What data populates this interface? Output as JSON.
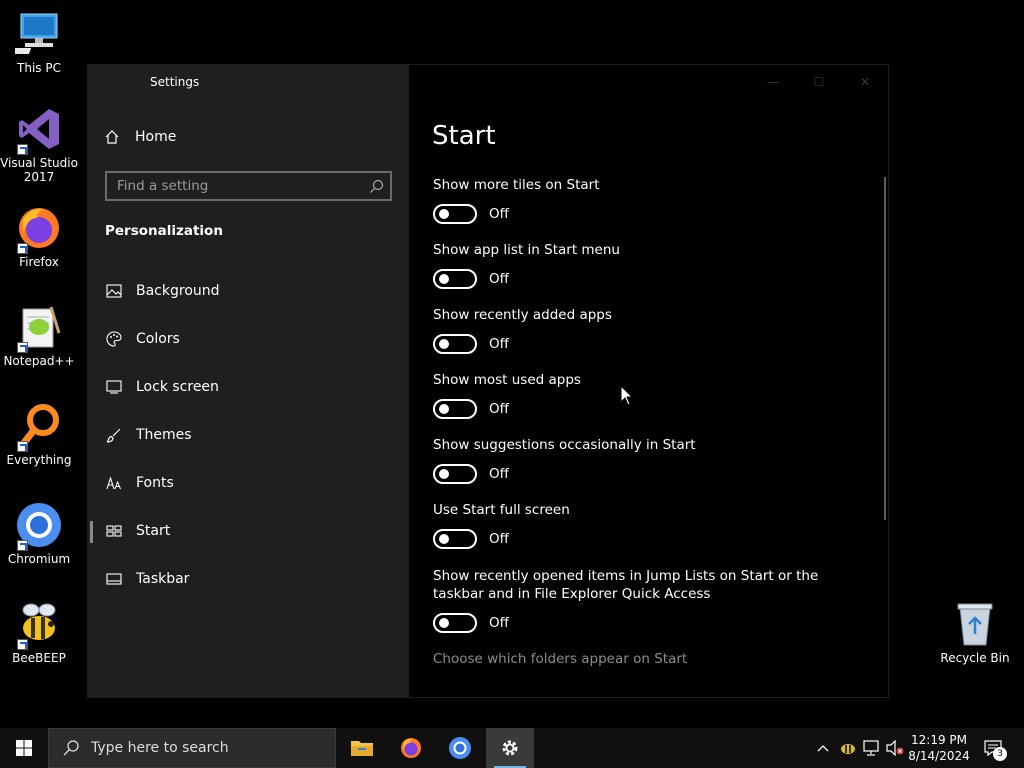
{
  "desktop": {
    "icons": [
      {
        "label": "This PC"
      },
      {
        "label": "Visual Studio 2017"
      },
      {
        "label": "Firefox"
      },
      {
        "label": "Notepad++"
      },
      {
        "label": "Everything"
      },
      {
        "label": "Chromium"
      },
      {
        "label": "BeeBEEP"
      },
      {
        "label": "Recycle Bin"
      }
    ]
  },
  "window": {
    "title": "Settings",
    "controls": {
      "minimize": "—",
      "maximize": "☐",
      "close": "✕"
    }
  },
  "sidebar": {
    "home_label": "Home",
    "search_placeholder": "Find a setting",
    "section_title": "Personalization",
    "items": [
      {
        "label": "Background",
        "icon": "image-icon"
      },
      {
        "label": "Colors",
        "icon": "palette-icon"
      },
      {
        "label": "Lock screen",
        "icon": "lock-screen-icon"
      },
      {
        "label": "Themes",
        "icon": "brush-icon"
      },
      {
        "label": "Fonts",
        "icon": "fonts-icon"
      },
      {
        "label": "Start",
        "icon": "start-icon",
        "active": true
      },
      {
        "label": "Taskbar",
        "icon": "taskbar-icon"
      }
    ]
  },
  "main": {
    "title": "Start",
    "options": [
      {
        "label": "Show more tiles on Start",
        "state": "Off"
      },
      {
        "label": "Show app list in Start menu",
        "state": "Off"
      },
      {
        "label": "Show recently added apps",
        "state": "Off"
      },
      {
        "label": "Show most used apps",
        "state": "Off"
      },
      {
        "label": "Show suggestions occasionally in Start",
        "state": "Off"
      },
      {
        "label": "Use Start full screen",
        "state": "Off"
      },
      {
        "label": "Show recently opened items in Jump Lists on Start or the taskbar and in File Explorer Quick Access",
        "state": "Off"
      }
    ],
    "link": "Choose which folders appear on Start"
  },
  "taskbar": {
    "search_placeholder": "Type here to search",
    "clock_time": "12:19 PM",
    "clock_date": "8/14/2024",
    "notification_count": "3"
  },
  "colors": {
    "sidebar_bg": "#1f1f1f",
    "content_bg": "#000000",
    "taskbar_bg": "#101010"
  }
}
